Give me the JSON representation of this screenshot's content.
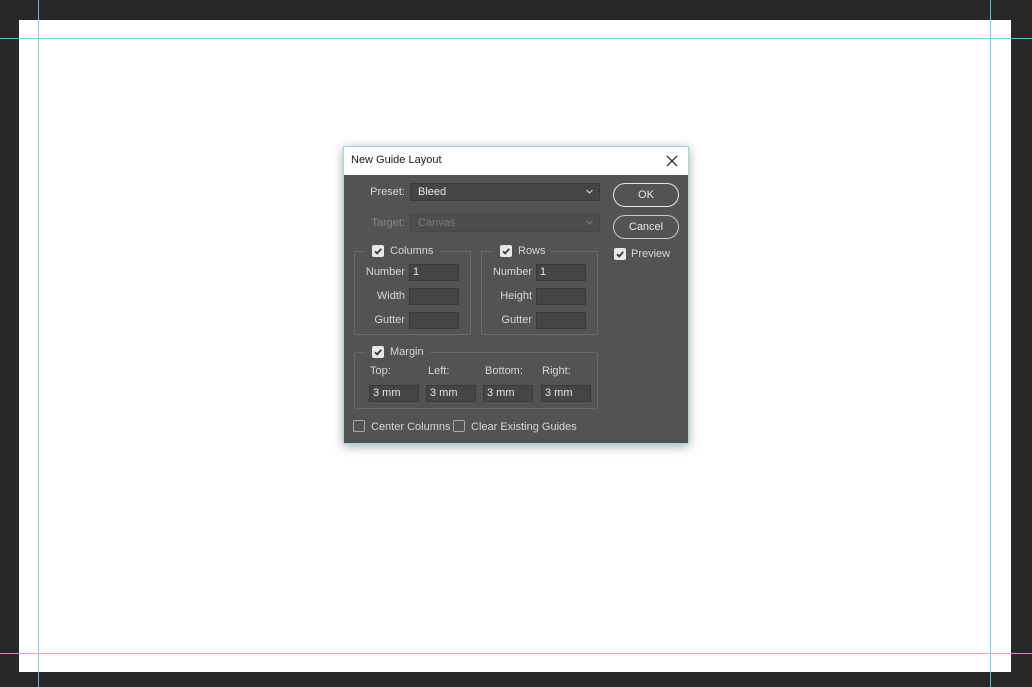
{
  "dialog": {
    "title": "New Guide Layout",
    "preset_label": "Preset:",
    "preset_value": "Bleed",
    "target_label": "Target:",
    "target_value": "Canvas",
    "ok_label": "OK",
    "cancel_label": "Cancel",
    "preview_label": "Preview",
    "preview_checked": true,
    "columns": {
      "label": "Columns",
      "checked": true,
      "number_label": "Number",
      "number_value": "1",
      "width_label": "Width",
      "width_value": "",
      "gutter_label": "Gutter",
      "gutter_value": ""
    },
    "rows": {
      "label": "Rows",
      "checked": true,
      "number_label": "Number",
      "number_value": "1",
      "height_label": "Height",
      "height_value": "",
      "gutter_label": "Gutter",
      "gutter_value": ""
    },
    "margin": {
      "label": "Margin",
      "checked": true,
      "top_label": "Top:",
      "top_value": "3 mm",
      "left_label": "Left:",
      "left_value": "3 mm",
      "bottom_label": "Bottom:",
      "bottom_value": "3 mm",
      "right_label": "Right:",
      "right_value": "3 mm"
    },
    "center_columns_label": "Center Columns",
    "center_columns_checked": false,
    "clear_guides_label": "Clear Existing Guides",
    "clear_guides_checked": false
  },
  "colors": {
    "workspace": "#282828",
    "canvas": "#ffffff",
    "guide": "#5fd4e0",
    "dialog_bg": "#535353"
  }
}
